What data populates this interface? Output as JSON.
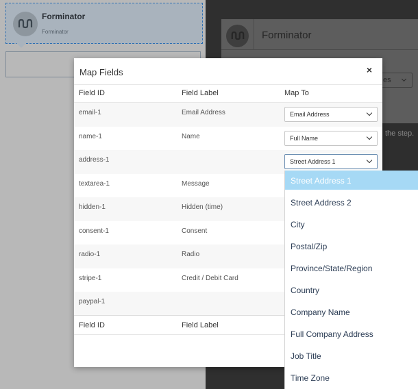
{
  "background": {
    "card_title": "Forminator",
    "card_subtitle": "Forminator",
    "panel_title": "Forminator",
    "panel_select_value": "es",
    "hint_text": "the step."
  },
  "modal": {
    "title": "Map Fields",
    "close_label": "×",
    "headers": {
      "field_id": "Field ID",
      "field_label": "Field Label",
      "map_to": "Map To"
    },
    "footer_headers": {
      "field_id": "Field ID",
      "field_label": "Field Label"
    },
    "rows": [
      {
        "id": "email-1",
        "label": "Email Address",
        "map": "Email Address"
      },
      {
        "id": "name-1",
        "label": "Name",
        "map": "Full Name"
      },
      {
        "id": "address-1",
        "label": "",
        "map": "Street Address 1"
      },
      {
        "id": "textarea-1",
        "label": "Message",
        "map": ""
      },
      {
        "id": "hidden-1",
        "label": "Hidden (time)",
        "map": ""
      },
      {
        "id": "consent-1",
        "label": "Consent",
        "map": ""
      },
      {
        "id": "radio-1",
        "label": "Radio",
        "map": ""
      },
      {
        "id": "stripe-1",
        "label": "Credit / Debit Card",
        "map": ""
      },
      {
        "id": "paypal-1",
        "label": "",
        "map": ""
      }
    ]
  },
  "dropdown": {
    "selected": "Street Address 1",
    "options": [
      "Street Address 1",
      "Street Address 2",
      "City",
      "Postal/Zip",
      "Province/State/Region",
      "Country",
      "Company Name",
      "Full Company Address",
      "Job Title",
      "Time Zone"
    ]
  },
  "colors": {
    "accent_selected": "#a6d9f5",
    "option_text": "#2c3d55"
  }
}
